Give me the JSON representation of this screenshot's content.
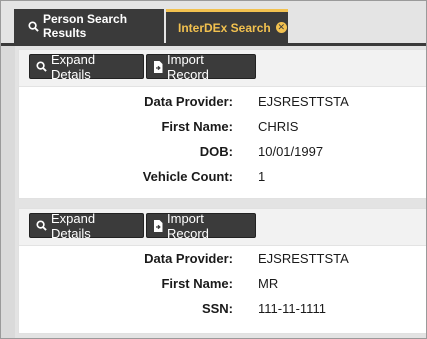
{
  "tabs": [
    {
      "label": "Person Search Results",
      "icon": "search-icon",
      "active": false
    },
    {
      "label": "InterDEx Search",
      "icon": "close-circle-icon",
      "active": true
    }
  ],
  "colors": {
    "tab_bg": "#3a3a3a",
    "active_tab_accent": "#f2c14f",
    "button_bg": "#3b3b3b",
    "card_toolbar_bg": "#f2f2f2",
    "page_bg": "#e3e3e3"
  },
  "records": [
    {
      "buttons": {
        "expand": "Expand Details",
        "import": "Import Record"
      },
      "fields": [
        {
          "label": "Data Provider:",
          "value": "EJSRESTTSTA"
        },
        {
          "label": "First Name:",
          "value": "CHRIS"
        },
        {
          "label": "DOB:",
          "value": "10/01/1997"
        },
        {
          "label": "Vehicle Count:",
          "value": "1"
        }
      ]
    },
    {
      "buttons": {
        "expand": "Expand Details",
        "import": "Import Record"
      },
      "fields": [
        {
          "label": "Data Provider:",
          "value": "EJSRESTTSTA"
        },
        {
          "label": "First Name:",
          "value": "MR"
        },
        {
          "label": "SSN:",
          "value": "111-11-1111"
        }
      ]
    }
  ]
}
